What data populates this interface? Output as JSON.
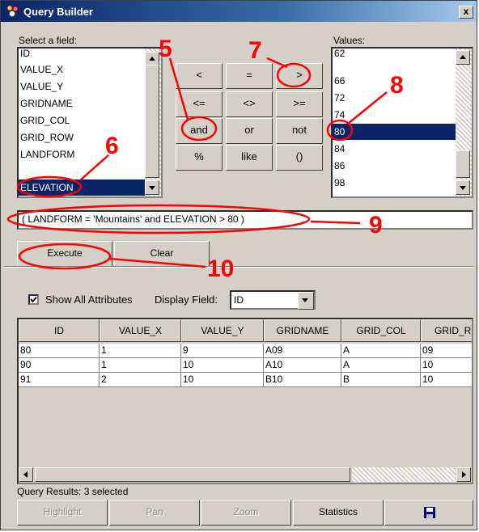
{
  "window": {
    "title": "Query Builder",
    "close_label": "x"
  },
  "fields": {
    "label": "Select a field:",
    "items": [
      "ID",
      "VALUE_X",
      "VALUE_Y",
      "GRIDNAME",
      "GRID_COL",
      "GRID_ROW",
      "LANDFORM",
      "ELEVATION"
    ],
    "selected": "ELEVATION"
  },
  "operators": [
    "<",
    "=",
    ">",
    "<=",
    "<>",
    ">=",
    "and",
    "or",
    "not",
    "%",
    "like",
    "()"
  ],
  "values": {
    "label": "Values:",
    "items": [
      "62",
      "66",
      "72",
      "74",
      "80",
      "84",
      "86",
      "98"
    ],
    "selected": "80"
  },
  "expression": "( LANDFORM = 'Mountains' and ELEVATION > 80 )",
  "buttons": {
    "execute": "Execute",
    "clear": "Clear"
  },
  "options": {
    "show_all_label": "Show All Attributes",
    "show_all_checked": true,
    "display_field_label": "Display Field:",
    "display_field_value": "ID"
  },
  "table": {
    "columns": [
      "ID",
      "VALUE_X",
      "VALUE_Y",
      "GRIDNAME",
      "GRID_COL",
      "GRID_ROW"
    ],
    "rows": [
      [
        "80",
        "1",
        "9",
        "A09",
        "A",
        "09"
      ],
      [
        "90",
        "1",
        "10",
        "A10",
        "A",
        "10"
      ],
      [
        "91",
        "2",
        "10",
        "B10",
        "B",
        "10"
      ]
    ]
  },
  "status": "Query Results: 3 selected",
  "bottom_buttons": {
    "highlight": "Highlight",
    "pan": "Pan",
    "zoom": "Zoom",
    "statistics": "Statistics"
  },
  "annotations": [
    "5",
    "6",
    "7",
    "8",
    "9",
    "10"
  ],
  "colors": {
    "annotation": "#ff0000",
    "selection": "#0a246a",
    "titlebar": "#0a246a"
  },
  "icons": {
    "app": "query-builder-icon",
    "save": "floppy-disk-icon",
    "close": "close-icon"
  }
}
